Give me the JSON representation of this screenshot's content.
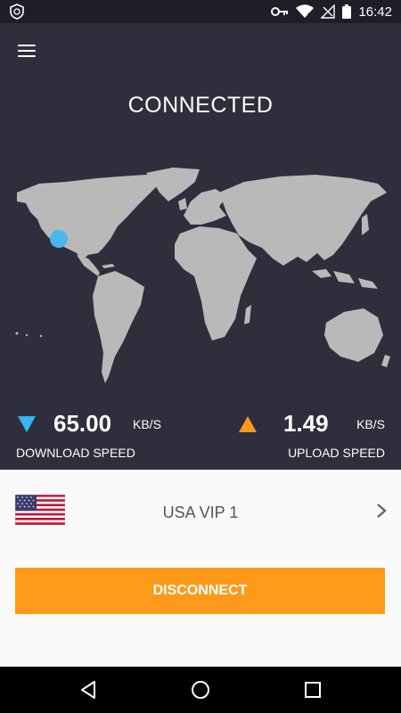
{
  "status_bar": {
    "time": "16:42"
  },
  "header": {
    "connection_status": "CONNECTED"
  },
  "speeds": {
    "download": {
      "value": "65.00",
      "unit": "KB/S",
      "label": "DOWNLOAD SPEED"
    },
    "upload": {
      "value": "1.49",
      "unit": "KB/S",
      "label": "UPLOAD SPEED"
    }
  },
  "server": {
    "name": "USA VIP 1",
    "flag": "us-flag-icon"
  },
  "actions": {
    "disconnect_label": "DISCONNECT"
  },
  "colors": {
    "background": "#2f2e3d",
    "map_land": "#b9b9b9",
    "location_marker": "#4bb8ea",
    "download_arrow": "#38b6f0",
    "upload_arrow": "#ff9a1a",
    "disconnect_button": "#ff9a1a",
    "panel": "#fafafa"
  }
}
